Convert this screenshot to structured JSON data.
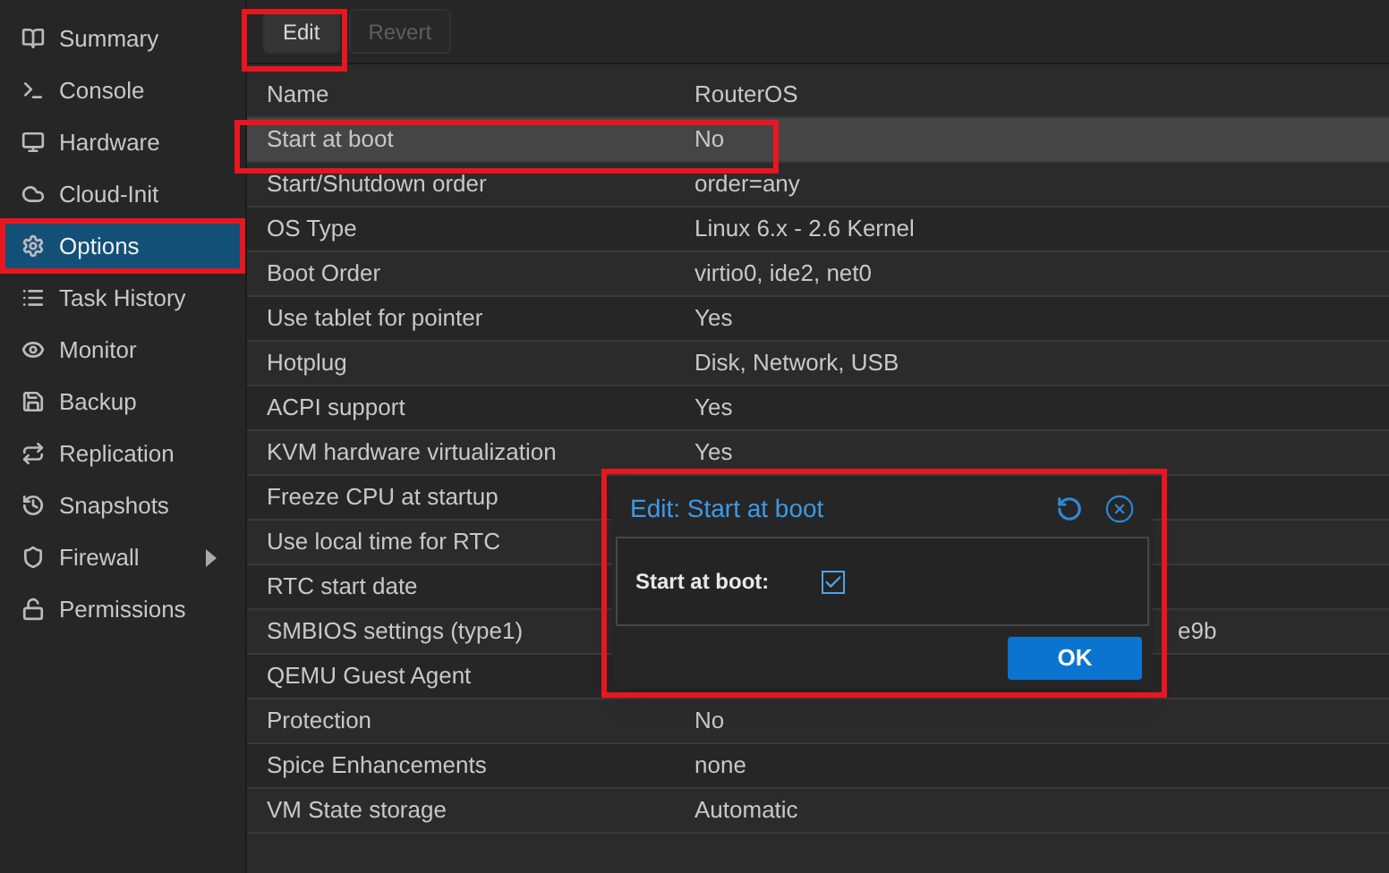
{
  "sidebar": {
    "items": [
      {
        "label": "Summary",
        "selected": false
      },
      {
        "label": "Console",
        "selected": false
      },
      {
        "label": "Hardware",
        "selected": false
      },
      {
        "label": "Cloud-Init",
        "selected": false
      },
      {
        "label": "Options",
        "selected": true
      },
      {
        "label": "Task History",
        "selected": false
      },
      {
        "label": "Monitor",
        "selected": false
      },
      {
        "label": "Backup",
        "selected": false
      },
      {
        "label": "Replication",
        "selected": false
      },
      {
        "label": "Snapshots",
        "selected": false
      },
      {
        "label": "Firewall",
        "selected": false,
        "submenu": true
      },
      {
        "label": "Permissions",
        "selected": false
      }
    ]
  },
  "toolbar": {
    "buttons": [
      {
        "label": "Edit",
        "disabled": false
      },
      {
        "label": "Revert",
        "disabled": true
      }
    ]
  },
  "table": {
    "rows": [
      {
        "name": "Name",
        "value": "RouterOS",
        "selected": false
      },
      {
        "name": "Start at boot",
        "value": "No",
        "selected": true
      },
      {
        "name": "Start/Shutdown order",
        "value": "order=any",
        "selected": false
      },
      {
        "name": "OS Type",
        "value": "Linux 6.x - 2.6 Kernel",
        "selected": false
      },
      {
        "name": "Boot Order",
        "value": "virtio0, ide2, net0",
        "selected": false
      },
      {
        "name": "Use tablet for pointer",
        "value": "Yes",
        "selected": false
      },
      {
        "name": "Hotplug",
        "value": "Disk, Network, USB",
        "selected": false
      },
      {
        "name": "ACPI support",
        "value": "Yes",
        "selected": false
      },
      {
        "name": "KVM hardware virtualization",
        "value": "Yes",
        "selected": false
      },
      {
        "name": "Freeze CPU at startup",
        "selected": false
      },
      {
        "name": "Use local time for RTC",
        "selected": false
      },
      {
        "name": "RTC start date",
        "selected": false
      },
      {
        "name": "SMBIOS settings (type1)",
        "value": "e9b",
        "covered": true,
        "selected": false
      },
      {
        "name": "QEMU Guest Agent",
        "selected": false
      },
      {
        "name": "Protection",
        "value": "No",
        "selected": false
      },
      {
        "name": "Spice Enhancements",
        "value": "none",
        "selected": false
      },
      {
        "name": "VM State storage",
        "value": "Automatic",
        "selected": false
      }
    ]
  },
  "dialog": {
    "title": "Edit: Start at boot",
    "field": {
      "label": "Start at boot:",
      "checked": true
    },
    "buttons": [
      "OK"
    ]
  }
}
